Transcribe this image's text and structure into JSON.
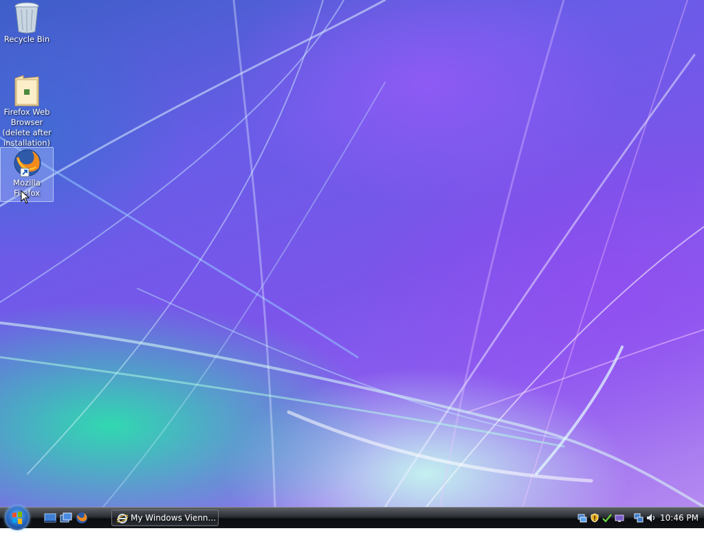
{
  "desktop": {
    "icons": [
      {
        "label": "Recycle Bin",
        "icon": "recycle-bin-icon",
        "selected": false
      },
      {
        "label": "Firefox Web Browser (delete after installation)",
        "icon": "folder-icon",
        "selected": false
      },
      {
        "label": "Mozilla Firefox",
        "icon": "firefox-icon",
        "selected": true
      }
    ]
  },
  "taskbar": {
    "start": {
      "icon": "windows-orb-icon"
    },
    "quick_launch": [
      {
        "icon": "show-desktop-icon"
      },
      {
        "icon": "switch-windows-icon"
      },
      {
        "icon": "firefox-icon"
      }
    ],
    "windows": [
      {
        "title": "My Windows Vienn...",
        "icon": "ie-icon"
      }
    ],
    "tray_icons": [
      "network-icon",
      "security-shield-icon",
      "safely-remove-icon",
      "display-icon",
      "network-connection-icon",
      "volume-icon"
    ],
    "clock": "10:46 PM"
  },
  "colors": {
    "taskbar": "#1a1c20",
    "selection": "#b4c8ff",
    "wallpaper_purple": "#7b55ea",
    "wallpaper_green": "#28e6aa"
  }
}
